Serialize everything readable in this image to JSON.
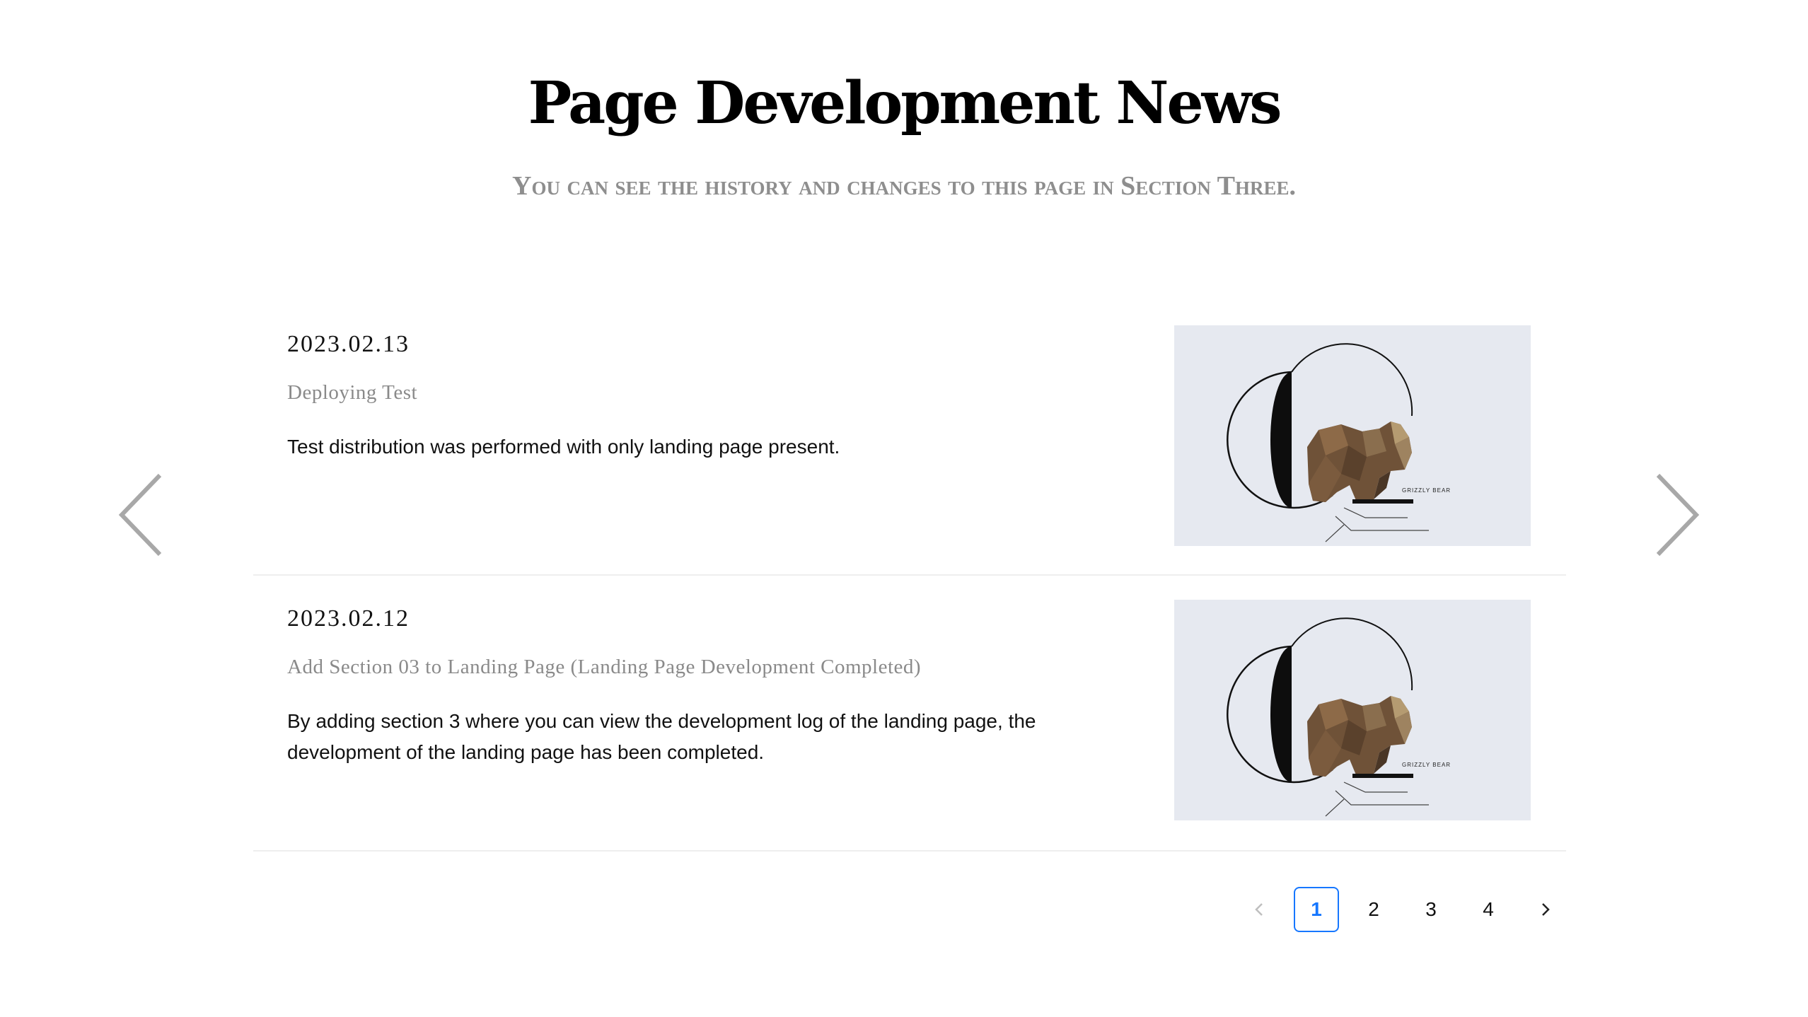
{
  "header": {
    "title": "Page Development News",
    "subtitle": "You can see the history and changes to this page in Section Three."
  },
  "carousel": {
    "prev_icon": "chevron-left-icon",
    "next_icon": "chevron-right-icon",
    "arrow_color": "#a8a8a8"
  },
  "news": [
    {
      "date": "2023.02.13",
      "title": "Deploying Test",
      "body": "Test distribution was performed with only landing page present.",
      "image_caption": "GRIZZLY BEAR"
    },
    {
      "date": "2023.02.12",
      "title": "Add Section 03 to Landing Page (Landing Page Development Completed)",
      "body": "By adding section 3 where you can view the development log of the landing page, the development of the landing page has been completed.",
      "image_caption": "GRIZZLY BEAR"
    }
  ],
  "pagination": {
    "prev_icon": "chevron-left-icon",
    "next_icon": "chevron-right-icon",
    "pages": [
      "1",
      "2",
      "3",
      "4"
    ],
    "current": "1",
    "accent_color": "#1677ff"
  }
}
